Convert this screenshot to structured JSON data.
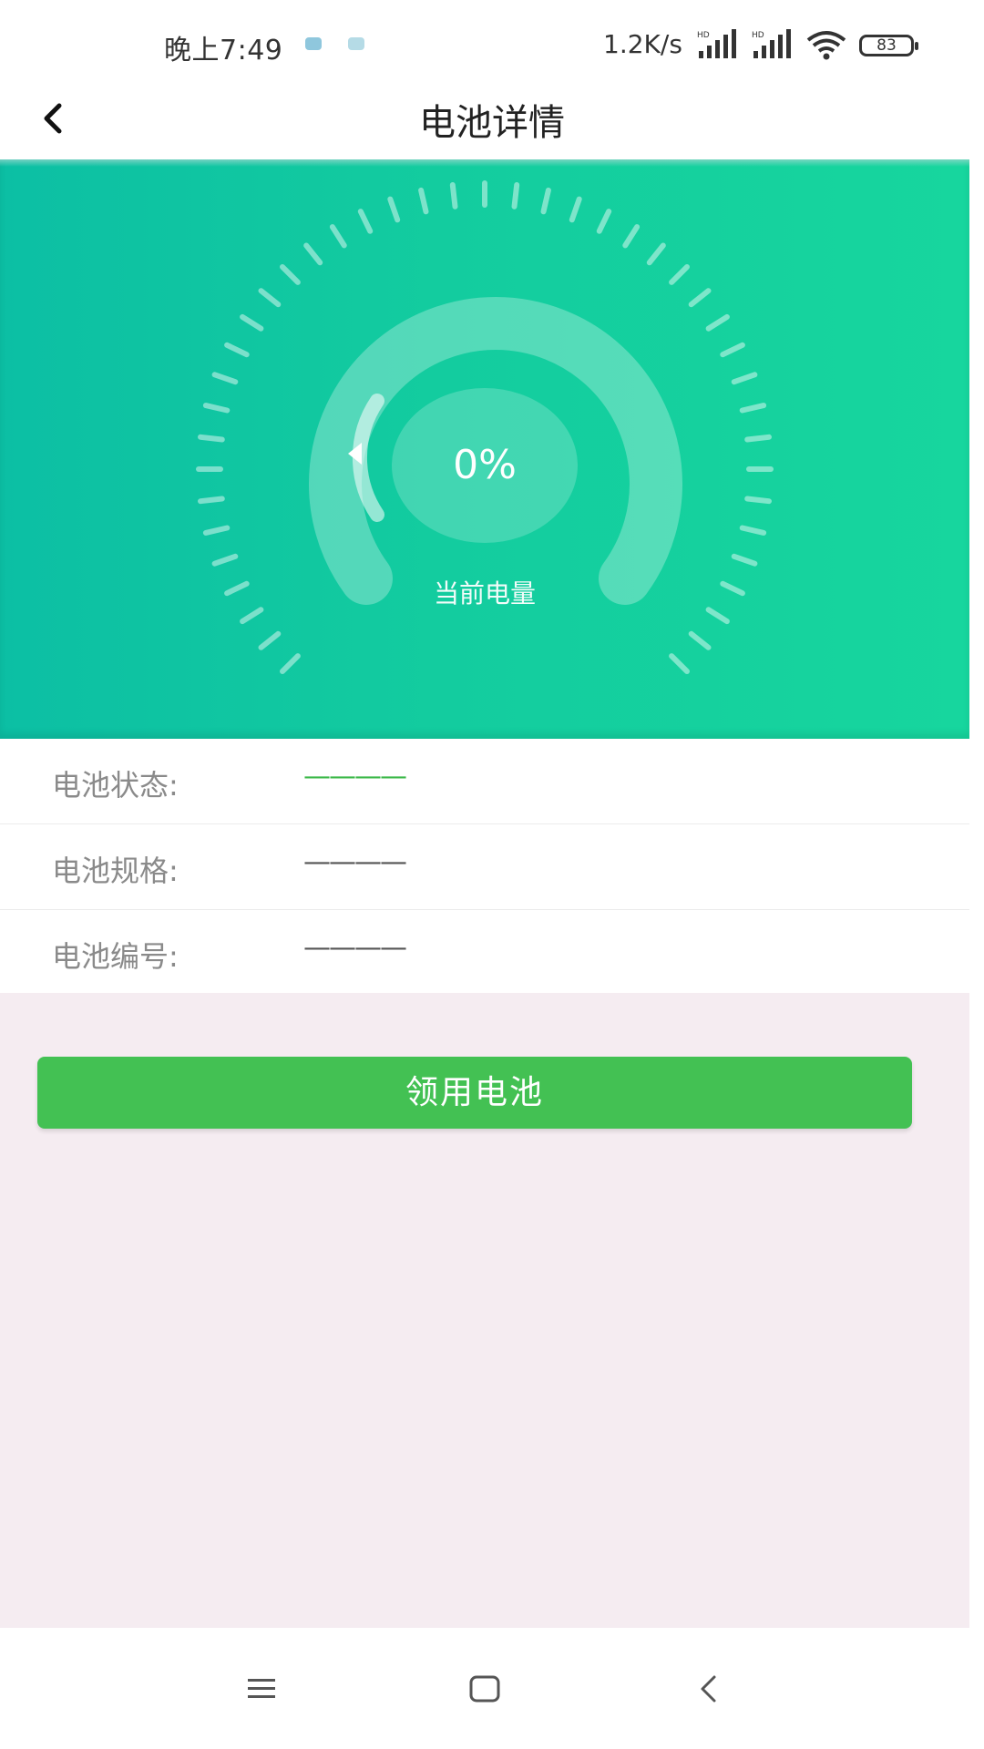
{
  "status_bar": {
    "time": "晚上7:49",
    "network_speed": "1.2K/s",
    "battery_level": "83",
    "icons": [
      "notification-icon",
      "notification-icon",
      "signal-hd-icon",
      "signal-hd-icon",
      "wifi-icon",
      "battery-icon"
    ]
  },
  "nav": {
    "title": "电池详情",
    "back_icon": "chevron-left-icon"
  },
  "gauge": {
    "value_text": "0%",
    "level_fraction": 0.0,
    "label": "当前电量"
  },
  "info": [
    {
      "label": "电池状态:",
      "value": "————",
      "value_color": "#3cb84a"
    },
    {
      "label": "电池规格:",
      "value": "————",
      "value_color": "#555555"
    },
    {
      "label": "电池编号:",
      "value": "————",
      "value_color": "#555555"
    }
  ],
  "action": {
    "claim_label": "领用电池",
    "color": "#43c153"
  },
  "system_nav": {
    "icons": [
      "menu-icon",
      "home-icon",
      "back-icon"
    ]
  },
  "colors": {
    "hero_gradient_start": "#0cbfa4",
    "hero_gradient_end": "#17d69e",
    "page_background": "#f5ecf1"
  }
}
